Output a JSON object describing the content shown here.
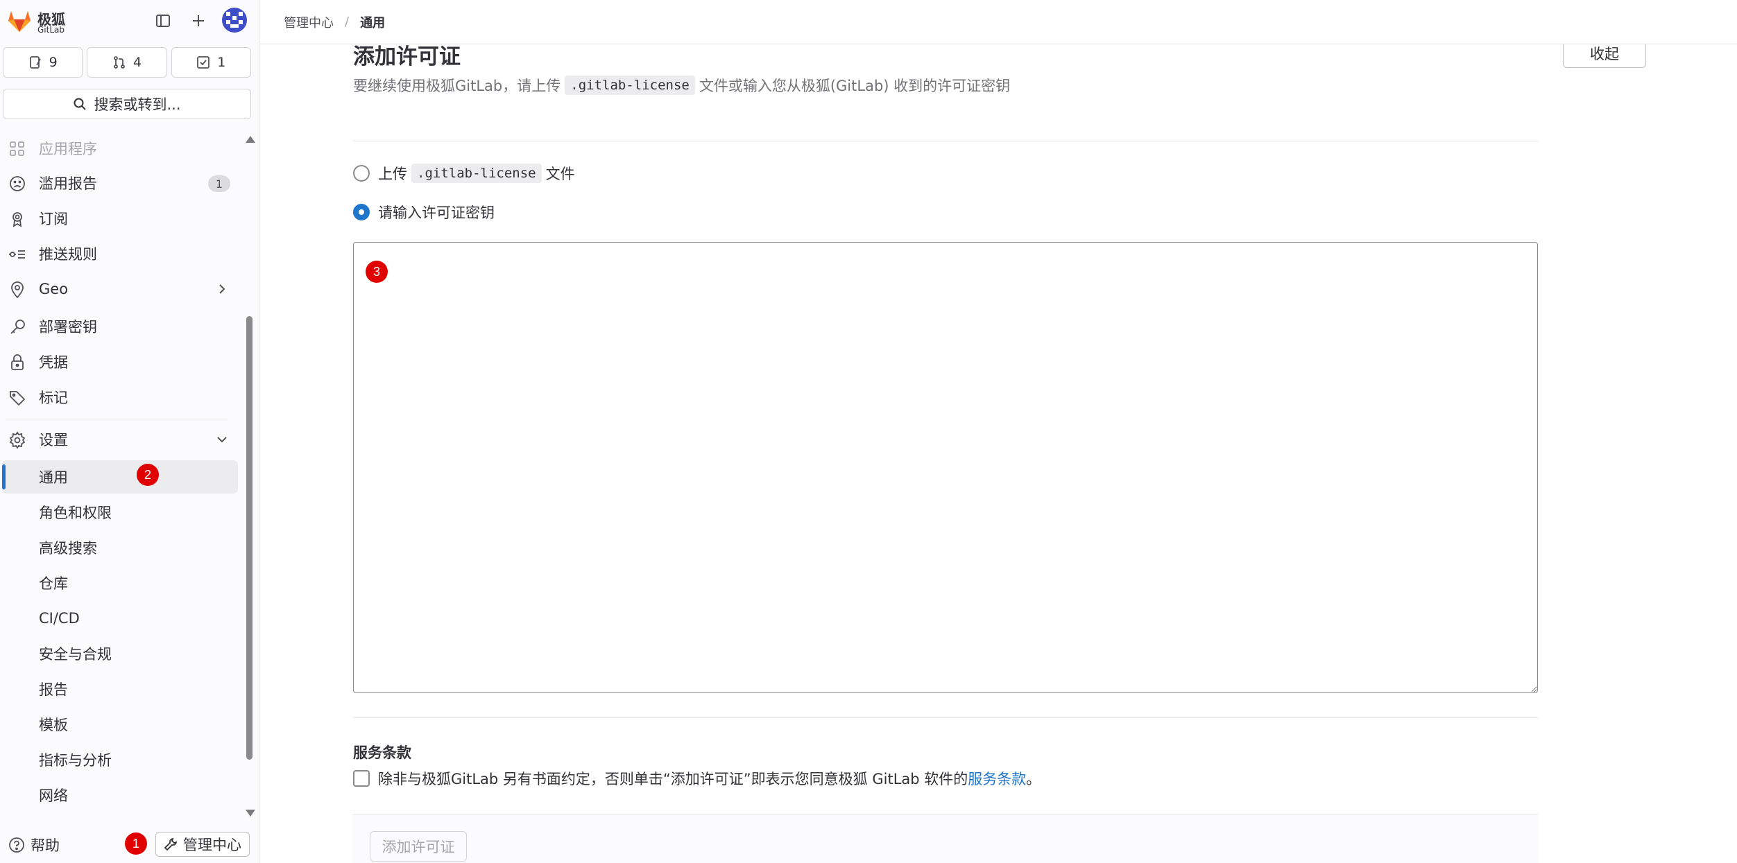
{
  "brand": {
    "name_cn": "极狐",
    "name_en": "GitLab"
  },
  "header": {
    "counters": [
      {
        "icon": "issues-icon",
        "count": "9"
      },
      {
        "icon": "merge-request-icon",
        "count": "4"
      },
      {
        "icon": "todo-icon",
        "count": "1"
      }
    ],
    "search_label": "搜索或转到..."
  },
  "sidebar": {
    "items": [
      {
        "label": "应用程序",
        "icon": "applications-icon"
      },
      {
        "label": "滥用报告",
        "icon": "abuse-report-icon",
        "badge": "1"
      },
      {
        "label": "订阅",
        "icon": "subscription-icon"
      },
      {
        "label": "推送规则",
        "icon": "push-rules-icon"
      },
      {
        "label": "Geo",
        "icon": "geo-icon"
      },
      {
        "label": "部署密钥",
        "icon": "deploy-key-icon"
      },
      {
        "label": "凭据",
        "icon": "credentials-icon"
      },
      {
        "label": "标记",
        "icon": "labels-icon"
      },
      {
        "label": "设置",
        "icon": "settings-icon"
      }
    ],
    "settings_sub": [
      "通用",
      "角色和权限",
      "高级搜索",
      "仓库",
      "CI/CD",
      "安全与合规",
      "报告",
      "模板",
      "指标与分析",
      "网络"
    ],
    "help_label": "帮助",
    "admin_label": "管理中心"
  },
  "breadcrumb": {
    "parent": "管理中心",
    "separator": "/",
    "current": "通用"
  },
  "main": {
    "title": "添加许可证",
    "collapse_label": "收起",
    "desc_before": "要继续使用极狐GitLab，请上传",
    "desc_code": ".gitlab-license",
    "desc_after": "文件或输入您从极狐(GitLab) 收到的许可证密钥",
    "upload_before": "上传",
    "upload_code": ".gitlab-license",
    "upload_after": "文件",
    "enter_key_label": "请输入许可证密钥",
    "tos_title": "服务条款",
    "tos_text": "除非与极狐GitLab 另有书面约定，否则单击“添加许可证”即表示您同意极狐 GitLab 软件的",
    "tos_link": "服务条款",
    "tos_period": "。",
    "submit_label": "添加许可证"
  },
  "markers": [
    "1",
    "2",
    "3"
  ],
  "colors": {
    "accent": "#1f75cb",
    "marker": "#e00000",
    "brand_orange": "#e24329"
  }
}
